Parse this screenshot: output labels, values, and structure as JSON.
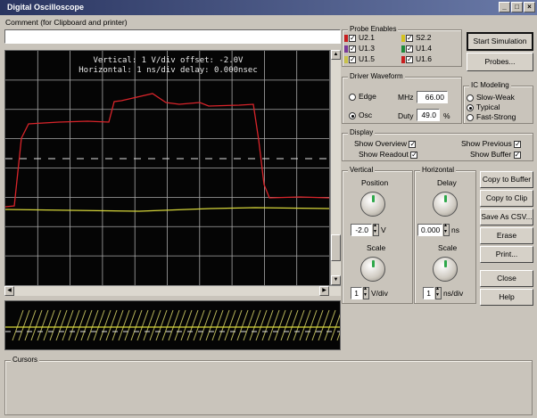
{
  "window": {
    "title": "Digital Oscilloscope",
    "controls": [
      "_",
      "□",
      "×"
    ]
  },
  "comment": {
    "label": "Comment (for Clipboard and printer)",
    "value": ""
  },
  "scope": {
    "readout_line1": "Vertical: 1 V/div  offset: -2.0V",
    "readout_line2": "Horizontal: 1 ns/div  delay: 0.000nsec",
    "colors": {
      "background": "#050505",
      "grid": "#a8a8a8",
      "trace_red": "#d8242a",
      "trace_yellow": "#d6d63a",
      "trace_white": "#e0e0e0"
    }
  },
  "probe_enables": {
    "label": "Probe Enables",
    "probes": [
      {
        "name": "U2.1",
        "color": "#c81e1e"
      },
      {
        "name": "S2.2",
        "color": "#d4c21e"
      },
      {
        "name": "U1.3",
        "color": "#7a3a9a"
      },
      {
        "name": "U1.4",
        "color": "#1e8a3a"
      },
      {
        "name": "U1.5",
        "color": "#c8c24a"
      },
      {
        "name": "U1.6",
        "color": "#c81e1e"
      }
    ]
  },
  "buttons": {
    "start_simulation": "Start Simulation",
    "probes": "Probes...",
    "copy_to_buffer": "Copy to Buffer",
    "copy_to_clip": "Copy to Clip",
    "save_as_csv": "Save As CSV...",
    "erase": "Erase",
    "print": "Print...",
    "close": "Close",
    "help": "Help"
  },
  "driver_waveform": {
    "label": "Driver Waveform",
    "options": [
      "Edge",
      "Osc"
    ],
    "selected": "Osc",
    "mhz_label": "MHz",
    "mhz_value": "66.00",
    "duty_label": "Duty",
    "duty_value": "49.0",
    "duty_unit": "%"
  },
  "ic_modeling": {
    "label": "IC Modeling",
    "options": [
      "Slow-Weak",
      "Typical",
      "Fast-Strong"
    ],
    "selected": "Typical"
  },
  "display": {
    "label": "Display",
    "show_overview": "Show Overview",
    "show_readout": "Show Readout",
    "show_previous": "Show Previous",
    "show_buffer": "Show Buffer"
  },
  "vertical": {
    "label": "Vertical",
    "position_label": "Position",
    "position_value": "-2.0",
    "position_unit": "V",
    "scale_label": "Scale",
    "scale_value": "1",
    "scale_unit": "V/div"
  },
  "horizontal": {
    "label": "Horizontal",
    "delay_label": "Delay",
    "delay_value": "0.000",
    "delay_unit": "ns",
    "scale_label": "Scale",
    "scale_value": "1",
    "scale_unit": "ns/div"
  },
  "cursors": {
    "label": "Cursors"
  }
}
